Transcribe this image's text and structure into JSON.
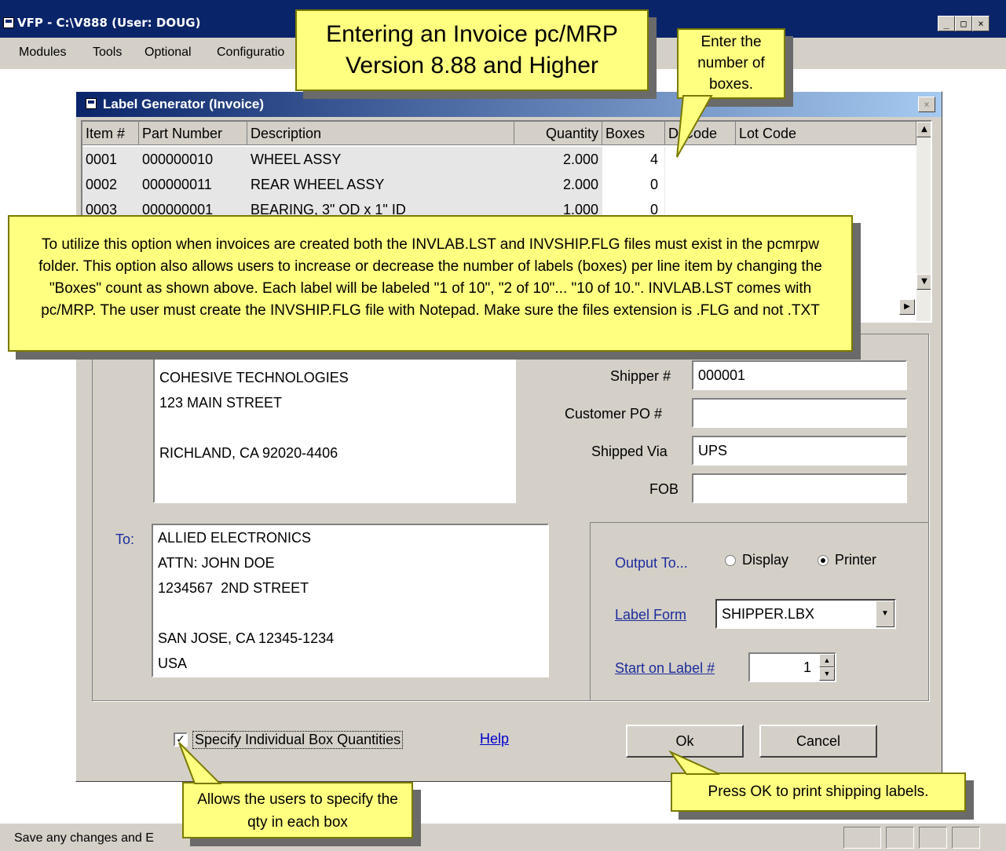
{
  "app": {
    "title": "VFP - C:\\V888  (User: DOUG)",
    "menu": [
      "Modules",
      "Tools",
      "Optional",
      "Configuratio"
    ],
    "status_text": "Save any changes and E"
  },
  "dialog": {
    "title": "Label Generator  (Invoice)",
    "grid": {
      "headers": [
        "Item #",
        "Part Number",
        "Description",
        "Quantity",
        "Boxes",
        "D-Code",
        "Lot Code"
      ],
      "rows": [
        {
          "item": "0001",
          "part": "000000010",
          "desc": "WHEEL ASSY",
          "qty": "2.000",
          "boxes": "4"
        },
        {
          "item": "0002",
          "part": "000000011",
          "desc": "REAR WHEEL ASSY",
          "qty": "2.000",
          "boxes": "0"
        },
        {
          "item": "0003",
          "part": "000000001",
          "desc": "BEARING, 3\" OD x 1\" ID",
          "qty": "1.000",
          "boxes": "0"
        }
      ]
    },
    "from_address": [
      "COHESIVE TECHNOLOGIES",
      "123 MAIN STREET",
      "",
      "RICHLAND, CA 92020-4406"
    ],
    "to_label": "To:",
    "to_address": [
      "ALLIED ELECTRONICS",
      "ATTN: JOHN DOE",
      "1234567  2ND STREET",
      "",
      "SAN JOSE, CA 12345-1234",
      "USA"
    ],
    "fields": {
      "shipper_label": "Shipper #",
      "shipper_value": "000001",
      "customer_po_label": "Customer PO #",
      "customer_po_value": "",
      "shipped_via_label": "Shipped Via",
      "shipped_via_value": "UPS",
      "fob_label": "FOB",
      "fob_value": ""
    },
    "output": {
      "label": "Output To...",
      "options": [
        "Display",
        "Printer"
      ],
      "selected": "Printer",
      "label_form_label": "Label Form",
      "label_form_value": "SHIPPER.LBX",
      "start_label": "Start on Label #",
      "start_value": "1"
    },
    "specify_checkbox_label": "Specify Individual Box Quantities",
    "specify_checked": true,
    "help_label": "Help",
    "ok_label": "Ok",
    "cancel_label": "Cancel"
  },
  "callouts": {
    "title_line1": "Entering an Invoice pc/MRP",
    "title_line2": "Version 8.88 and Higher",
    "boxes_note": "Enter the number of boxes.",
    "info_text": "To utilize this option when invoices are created both the INVLAB.LST and INVSHIP.FLG files must exist in the pcmrpw folder. This option also allows users to increase or decrease the number of labels (boxes) per line item by changing the \"Boxes\" count as shown above. Each label will be labeled \"1 of 10\", \"2 of 10\"... \"10 of 10.\".  INVLAB.LST comes with pc/MRP.  The user must create the INVSHIP.FLG file with Notepad. Make sure the files extension is .FLG and not .TXT",
    "qty_note": "Allows the users to specify the qty  in each box",
    "ok_note": "Press OK to print shipping labels."
  },
  "colors": {
    "title_bar": "#0a246a",
    "callout_fill": "#ffff80",
    "dialog_face": "#d4d0c8"
  }
}
